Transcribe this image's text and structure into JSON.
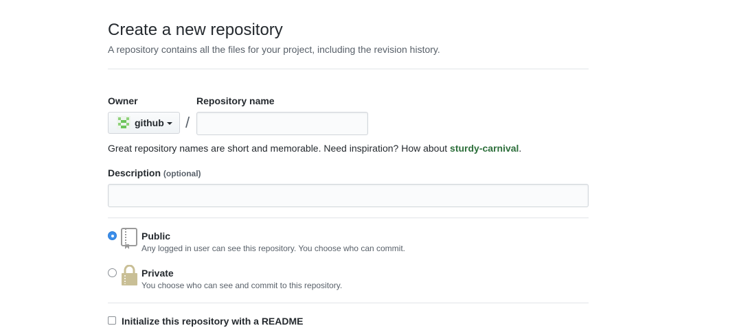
{
  "header": {
    "title": "Create a new repository",
    "subtitle": "A repository contains all the files for your project, including the revision history."
  },
  "owner": {
    "label": "Owner",
    "value": "github",
    "separator": "/"
  },
  "repo_name": {
    "label": "Repository name",
    "value": "",
    "placeholder": ""
  },
  "hint": {
    "text": "Great repository names are short and memorable. Need inspiration? How about ",
    "suggestion": "sturdy-carnival",
    "end": "."
  },
  "description": {
    "label": "Description",
    "optional": "(optional)",
    "value": "",
    "placeholder": ""
  },
  "visibility": {
    "selected": "public",
    "options": [
      {
        "id": "public",
        "title": "Public",
        "desc": "Any logged in user can see this repository. You choose who can commit.",
        "icon": "repo-book-icon"
      },
      {
        "id": "private",
        "title": "Private",
        "desc": "You choose who can see and commit to this repository.",
        "icon": "lock-icon"
      }
    ]
  },
  "init_readme": {
    "label": "Initialize this repository with a README",
    "checked": false
  },
  "colors": {
    "accent": "#3b8eea",
    "suggestion": "#2c6e3a",
    "border": "#d1d5da",
    "muted": "#586069",
    "icon_fill": "#c9bf96"
  }
}
